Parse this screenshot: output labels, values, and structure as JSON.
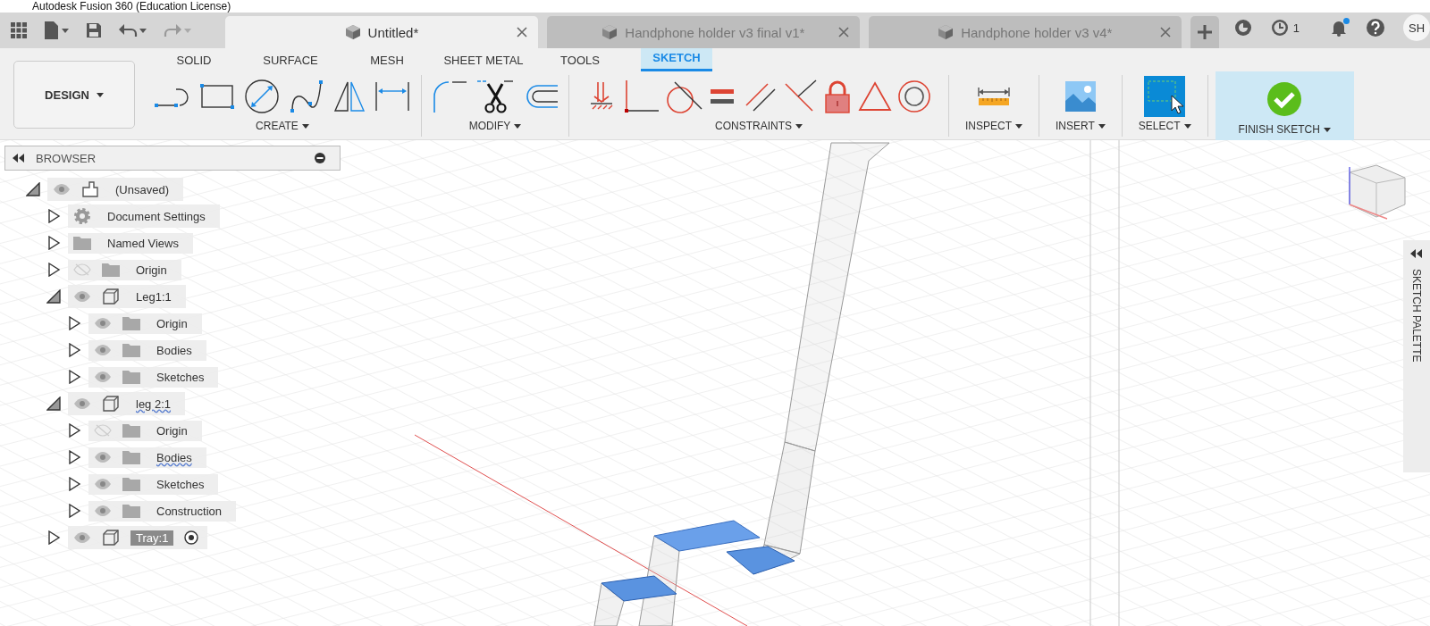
{
  "window": {
    "title": "Autodesk Fusion 360 (Education License)"
  },
  "doc_tabs": [
    {
      "label": "Untitled*",
      "selected": true
    },
    {
      "label": "Handphone holder v3 final v1*",
      "selected": false
    },
    {
      "label": "Handphone holder v3 v4*",
      "selected": false
    }
  ],
  "topbar": {
    "jobs_count": "1",
    "notifications_unread": true,
    "avatar": "SH"
  },
  "workspace": {
    "label": "DESIGN"
  },
  "toolbar_tabs": [
    {
      "label": "SOLID",
      "selected": false
    },
    {
      "label": "SURFACE",
      "selected": false
    },
    {
      "label": "MESH",
      "selected": false
    },
    {
      "label": "SHEET METAL",
      "selected": false
    },
    {
      "label": "TOOLS",
      "selected": false
    },
    {
      "label": "SKETCH",
      "selected": true
    }
  ],
  "tool_groups": [
    {
      "kind": "create",
      "label": "CREATE"
    },
    {
      "kind": "modify",
      "label": "MODIFY"
    },
    {
      "kind": "constraints",
      "label": "CONSTRAINTS"
    },
    {
      "kind": "inspect",
      "label": "INSPECT"
    },
    {
      "kind": "insert",
      "label": "INSERT"
    },
    {
      "kind": "select",
      "label": "SELECT"
    },
    {
      "kind": "finish",
      "label": "FINISH SKETCH"
    }
  ],
  "browser": {
    "title": "BROWSER",
    "tree": [
      {
        "label": "(Unsaved)",
        "kind": "root",
        "visible": true,
        "expanded": true,
        "children": [
          {
            "label": "Document Settings",
            "kind": "settings",
            "expanded": false
          },
          {
            "label": "Named Views",
            "kind": "folder",
            "expanded": false
          },
          {
            "label": "Origin",
            "kind": "folder",
            "visible": false,
            "expanded": false
          },
          {
            "label": "Leg1:1",
            "kind": "component",
            "visible": true,
            "expanded": true,
            "active": false,
            "children": [
              {
                "label": "Origin",
                "kind": "folder",
                "visible": true,
                "expanded": false
              },
              {
                "label": "Bodies",
                "kind": "folder",
                "visible": true,
                "expanded": false
              },
              {
                "label": "Sketches",
                "kind": "folder",
                "visible": true,
                "expanded": false
              }
            ]
          },
          {
            "label": "leg 2:1",
            "kind": "component",
            "visible": true,
            "expanded": true,
            "active": false,
            "warning": true,
            "children": [
              {
                "label": "Origin",
                "kind": "folder",
                "visible": false,
                "expanded": false
              },
              {
                "label": "Bodies",
                "kind": "folder",
                "visible": true,
                "expanded": false,
                "warning": true
              },
              {
                "label": "Sketches",
                "kind": "folder",
                "visible": true,
                "expanded": false
              },
              {
                "label": "Construction",
                "kind": "folder",
                "visible": true,
                "expanded": false
              }
            ]
          },
          {
            "label": "Tray:1",
            "kind": "component",
            "visible": true,
            "expanded": false,
            "active": true
          }
        ]
      }
    ]
  },
  "sketch_palette": {
    "label": "SKETCH PALETTE"
  }
}
